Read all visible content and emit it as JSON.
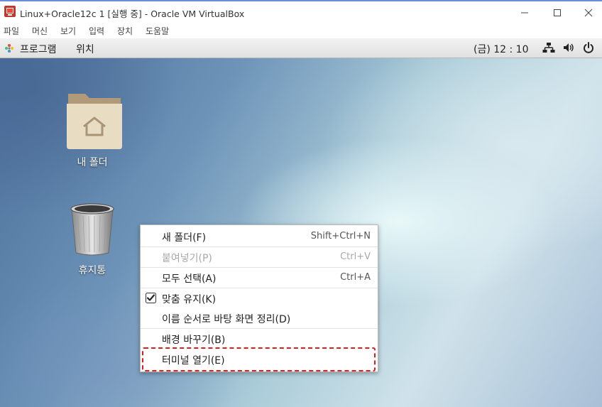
{
  "window": {
    "title": "Linux+Oracle12c 1 [실행 중] - Oracle VM VirtualBox",
    "icon": "virtualbox-icon"
  },
  "menubar": {
    "items": [
      "파일",
      "머신",
      "보기",
      "입력",
      "장치",
      "도움말"
    ]
  },
  "guest_panel": {
    "applications_label": "프로그램",
    "places_label": "위치",
    "clock": "(금) 12 : 10"
  },
  "desktop": {
    "icons": [
      {
        "label": "내 폴더",
        "icon": "home-folder-icon"
      },
      {
        "label": "휴지통",
        "icon": "trash-icon"
      }
    ]
  },
  "context_menu": {
    "items": [
      {
        "label": "새 폴더(F)",
        "accel": "Shift+Ctrl+N",
        "enabled": true
      },
      {
        "label": "붙여넣기(P)",
        "accel": "Ctrl+V",
        "enabled": false
      },
      {
        "label": "모두 선택(A)",
        "accel": "Ctrl+A",
        "enabled": true
      },
      {
        "label": "맞춤 유지(K)",
        "accel": "",
        "checked": true
      },
      {
        "label": "이름 순서로 바탕 화면 정리(D)",
        "accel": ""
      },
      {
        "label": "배경 바꾸기(B)",
        "accel": ""
      },
      {
        "label": "터미널 열기(E)",
        "accel": ""
      }
    ]
  },
  "colors": {
    "highlight_border": "#e01b1b",
    "titlebar_accent": "#6b8fd6"
  }
}
